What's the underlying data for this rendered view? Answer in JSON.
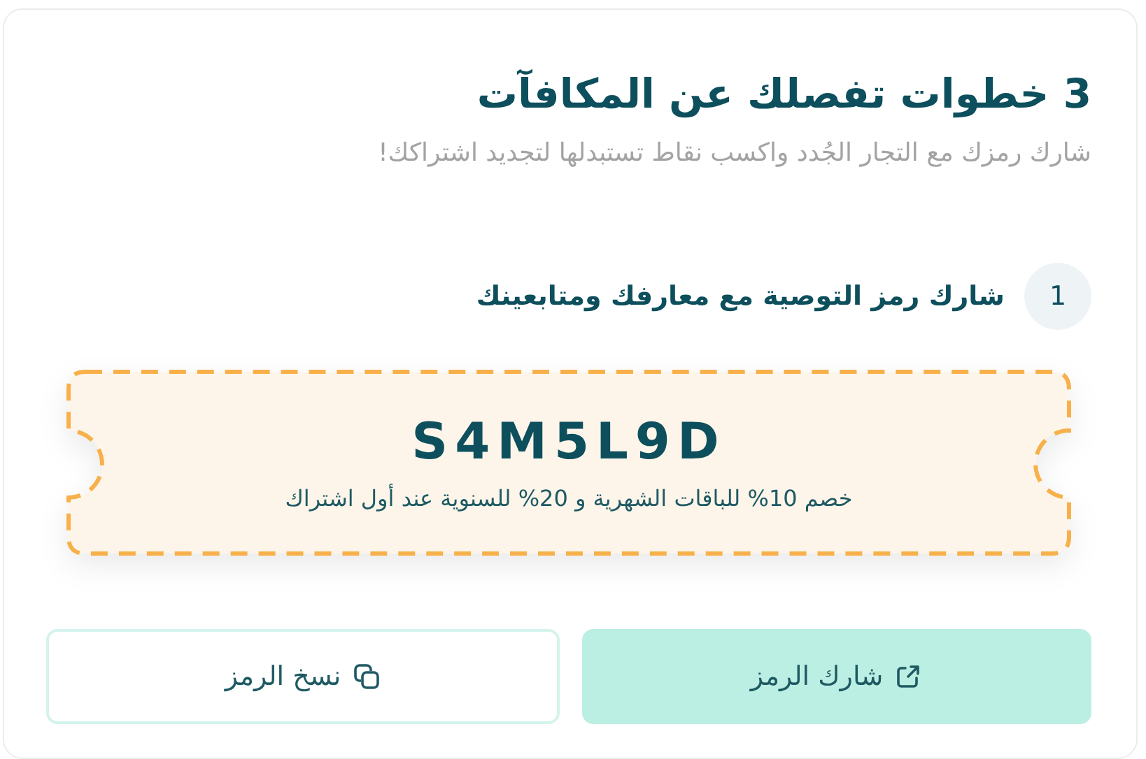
{
  "card": {
    "title": "3 خطوات تفصلك عن المكافآت",
    "subtitle": "شارك رمزك مع التجار الجُدد واكسب نقاط تستبدلها لتجديد اشتراكك!"
  },
  "step": {
    "number": "1",
    "label": "شارك رمز التوصية مع معارفك ومتابعينك"
  },
  "coupon": {
    "code": "S4M5L9D",
    "description": "خصم 10% للباقات الشهرية و 20% للسنوية عند أول اشتراك"
  },
  "buttons": [
    {
      "kind": "share",
      "label": "شارك الرمز"
    },
    {
      "kind": "copy",
      "label": "نسخ الرمز"
    }
  ]
}
